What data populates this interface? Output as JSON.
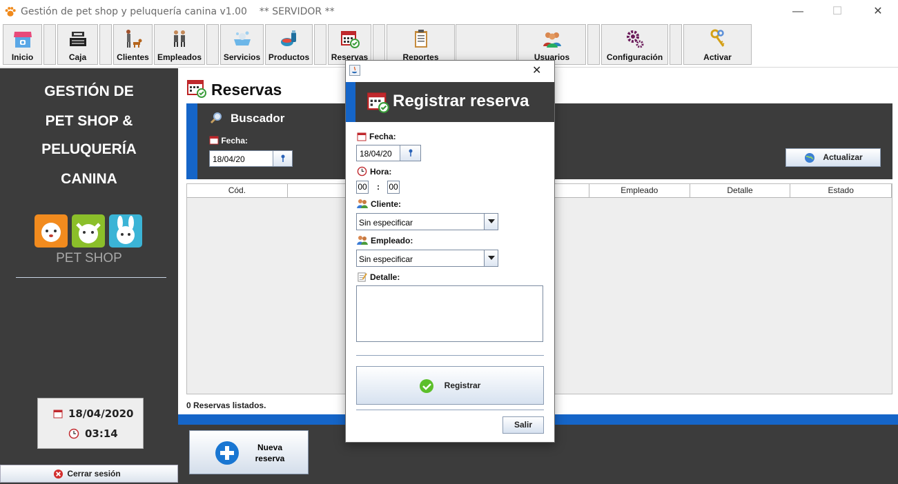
{
  "window": {
    "title": "Gestión de pet shop y peluquería canina v1.00",
    "server": "** SERVIDOR **",
    "minimize": "—",
    "maximize": "☐",
    "close": "✕"
  },
  "toolbar": {
    "items": [
      {
        "label": "Inicio",
        "icon": "store-icon"
      },
      {
        "label": "Caja",
        "icon": "cash-register-icon"
      },
      {
        "label": "Clientes",
        "icon": "person-dog-icon"
      },
      {
        "label": "Empleados",
        "icon": "employees-icon"
      },
      {
        "label": "Servicios",
        "icon": "dog-bath-icon"
      },
      {
        "label": "Productos",
        "icon": "products-icon"
      },
      {
        "label": "Reservas",
        "icon": "calendar-check-icon"
      },
      {
        "label": "Reportes",
        "icon": "clipboard-icon"
      },
      {
        "label": "Usuarios",
        "icon": "users-icon"
      },
      {
        "label": "Configuración",
        "icon": "gears-icon"
      },
      {
        "label": "Activar",
        "icon": "keys-icon"
      }
    ]
  },
  "sidebar": {
    "title_lines": [
      "GESTIÓN DE",
      "PET SHOP &",
      "PELUQUERÍA",
      "CANINA"
    ],
    "logo_text": "PET SHOP",
    "date": "18/04/2020",
    "time": "03:14",
    "logout_label": "Cerrar sesión"
  },
  "main": {
    "title": "Reservas",
    "search_title": "Buscador",
    "date_label": "Fecha:",
    "date_value": "18/04/20",
    "refresh_label": "Actualizar",
    "columns": [
      "Cód.",
      "",
      "",
      "",
      "Empleado",
      "Detalle",
      "Estado"
    ],
    "status": "0 Reservas listados.",
    "new_button_line1": "Nueva",
    "new_button_line2": "reserva"
  },
  "dialog": {
    "title": "Registrar reserva",
    "fecha_label": "Fecha:",
    "fecha_value": "18/04/20",
    "hora_label": "Hora:",
    "hour": "00",
    "minute": "00",
    "time_sep": ":",
    "cliente_label": "Cliente:",
    "cliente_value": "Sin especificar",
    "empleado_label": "Empleado:",
    "empleado_value": "Sin especificar",
    "detalle_label": "Detalle:",
    "detalle_value": "",
    "register_label": "Registrar",
    "exit_label": "Salir",
    "close": "✕"
  },
  "colors": {
    "accent_blue": "#1565c8",
    "panel_dark": "#3c3c3c",
    "success_green": "#5cbf2a",
    "danger_red": "#d32f2f"
  }
}
